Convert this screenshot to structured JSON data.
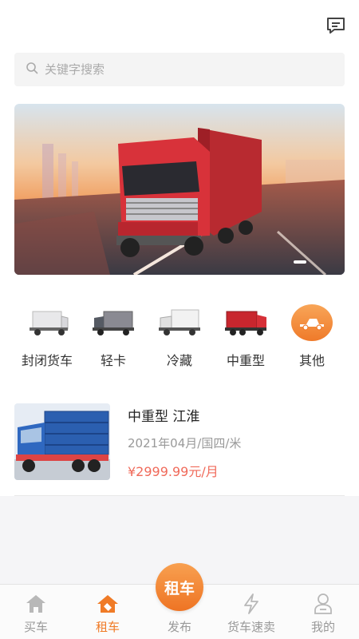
{
  "search": {
    "placeholder": "关键字搜索"
  },
  "categories": [
    {
      "label": "封闭货车",
      "icon": "closed-truck-icon"
    },
    {
      "label": "轻卡",
      "icon": "light-truck-icon"
    },
    {
      "label": "冷藏",
      "icon": "refrigerated-truck-icon"
    },
    {
      "label": "中重型",
      "icon": "heavy-truck-icon"
    },
    {
      "label": "其他",
      "icon": "pickup-truck-icon"
    }
  ],
  "listing": {
    "title": "中重型 江淮",
    "subtitle": "2021年04月/国四/米",
    "price": "¥2999.99元/月"
  },
  "tabbar": {
    "tabs": [
      {
        "label": "买车",
        "icon": "home-icon"
      },
      {
        "label": "租车",
        "icon": "rent-icon"
      },
      {
        "label": "发布",
        "icon": "publish-icon"
      },
      {
        "label": "货车速卖",
        "icon": "lightning-icon"
      },
      {
        "label": "我的",
        "icon": "user-icon"
      }
    ],
    "active_index": 1,
    "publish_button": "租车"
  },
  "colors": {
    "accent": "#f07b27",
    "price": "#f06a5a"
  }
}
